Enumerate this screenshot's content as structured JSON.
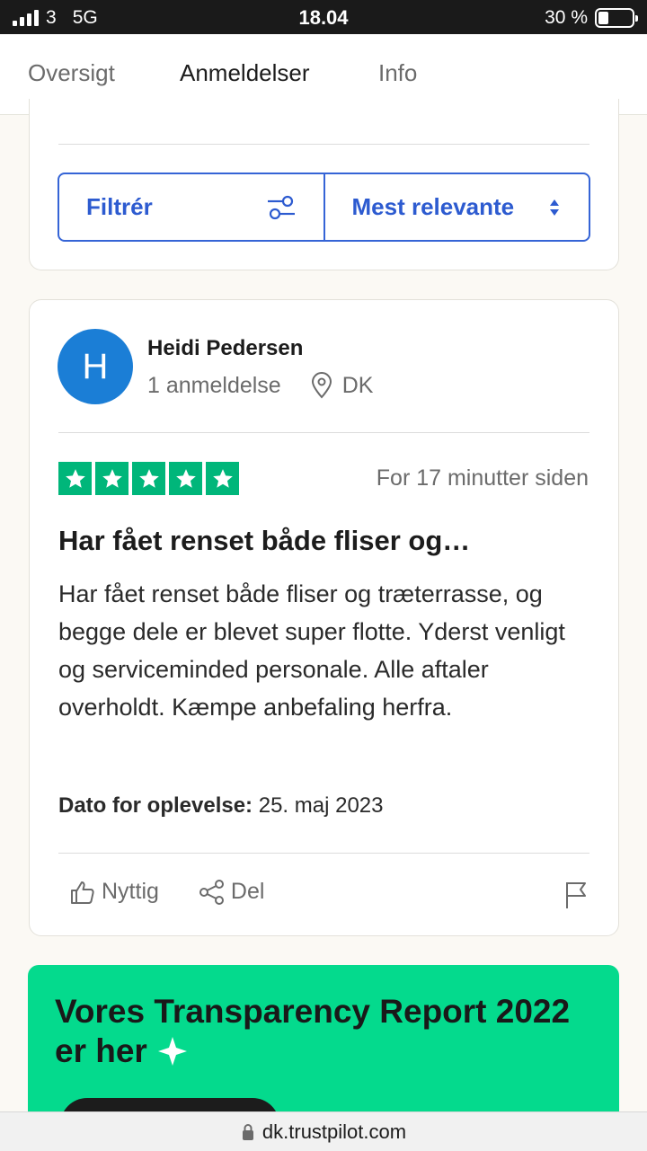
{
  "status_bar": {
    "carrier": "3",
    "network": "5G",
    "time": "18.04",
    "battery": "30 %"
  },
  "tabs": [
    {
      "label": "Oversigt"
    },
    {
      "label": "Anmeldelser"
    },
    {
      "label": "Info"
    }
  ],
  "filter": {
    "filter_label": "Filtrér",
    "sort_label": "Mest relevante"
  },
  "review": {
    "avatar_letter": "H",
    "name": "Heidi Pedersen",
    "review_count": "1 anmeldelse",
    "country": "DK",
    "rating": 5,
    "max_rating": 5,
    "time_ago": "For 17 minutter siden",
    "title": "Har fået renset både fliser og…",
    "body": "Har fået renset både fliser og træterrasse, og begge dele er blevet super flotte. Yderst venligt og serviceminded personale. Alle aftaler overholdt. Kæmpe anbefaling herfra.",
    "date_label": "Dato for oplevelse:",
    "date_value": "25. maj 2023",
    "useful_label": "Nyttig",
    "share_label": "Del"
  },
  "promo": {
    "title": "Vores Transparency Report 2022 er her"
  },
  "url_bar": {
    "url": "dk.trustpilot.com"
  },
  "colors": {
    "brand_green": "#00b67a",
    "link_blue": "#2d5bd0",
    "avatar_blue": "#1b7ed6",
    "promo_green": "#04da8d"
  }
}
